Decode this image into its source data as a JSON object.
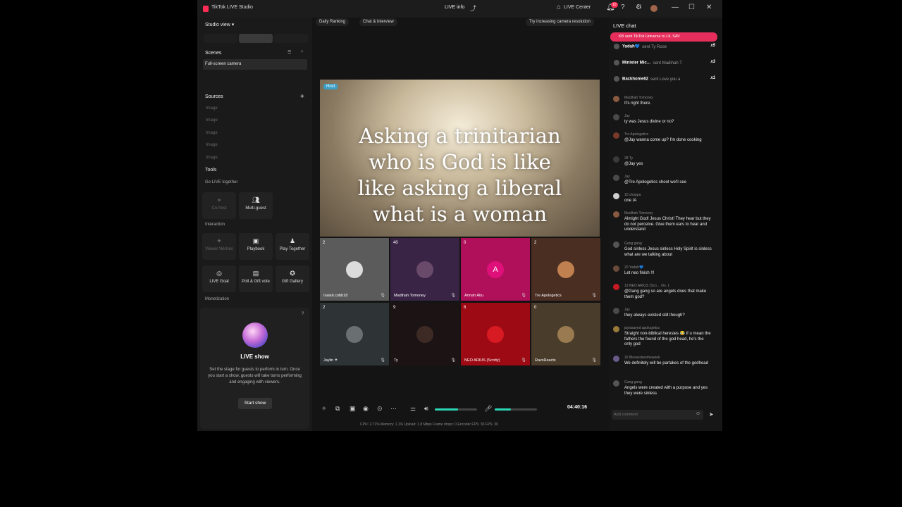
{
  "app": {
    "title": "TikTok LIVE Studio",
    "center_title": "LIVE info",
    "live_center": "LIVE Center",
    "notif_count": "10"
  },
  "sidebar": {
    "studio_view": "Studio view ▾",
    "scenes_header": "Scenes",
    "scene_item": "Full-screen camera",
    "sources_header": "Sources",
    "sources": [
      "Image",
      "Image",
      "Image",
      "Image",
      "Image"
    ],
    "tools_header": "Tools",
    "go_live_together": "Go LIVE together",
    "tools_golive": [
      "Co-host",
      "Multi-guest"
    ],
    "interaction": "Interaction",
    "tools_interaction": [
      "Viewer Wishes",
      "Playbook",
      "Play Together",
      "LIVE Goal",
      "Poll & Gift vote",
      "Gift Gallery"
    ],
    "monetization": "Monetization",
    "live_show": {
      "title": "LIVE show",
      "desc": "Set the stage for guests to perform in turn. Once you start a show, guests will take turns performing and engaging with viewers.",
      "button": "Start show"
    }
  },
  "top_pills": {
    "daily_ranking": "Daily Ranking",
    "chat_interview": "Chat & interview",
    "tip": "Try increasing camera resolution"
  },
  "main_video": {
    "host_tag": "Host",
    "lines": [
      "Asking a trinitarian",
      "who is God is like",
      "like asking a liberal",
      "what is a woman"
    ]
  },
  "guests": [
    {
      "count": "2",
      "name": "Isaiah.cobb18",
      "color": "#5b5b5b",
      "avatar": "#dcdcdc"
    },
    {
      "count": "40",
      "name": "Madihah Tomoney",
      "color": "#3a2446",
      "avatar": "#6a4a6a"
    },
    {
      "count": "0",
      "name": "Armah Abu",
      "color": "#b0105a",
      "avatar": "#e0107a",
      "initial": "A"
    },
    {
      "count": "2",
      "name": "Tre Apologetics",
      "color": "#4a2e22",
      "avatar": "#c08050"
    },
    {
      "count": "2",
      "name": "Jaylin ✝",
      "color": "#2e3436",
      "avatar": "#6a7072"
    },
    {
      "count": "9",
      "name": "Ty",
      "color": "#1c1414",
      "avatar": "#3e2a24"
    },
    {
      "count": "6",
      "name": "NEO ARIUS (Scotty)",
      "color": "#9e0a14",
      "avatar": "#d81a22"
    },
    {
      "count": "0",
      "name": "RavsReacts",
      "color": "#4a3c2a",
      "avatar": "#9a7a50"
    }
  ],
  "toolbar": {
    "timer": "04:40:16",
    "speaker_level": 0.55,
    "mic_level": 0.38
  },
  "stats": "CPU: 2.71%    Memory: 1.1%    Upload: 1.8 Mbps    Frame drops: 0    Encoder FPS: 30    FPS: 30",
  "chat": {
    "header": "LIVE chat",
    "banner": "KB sent TikTok Universe to LIL SAV",
    "gifts": [
      {
        "user": "Yadah💙",
        "text": "sent Ty Rose",
        "mult": "x5"
      },
      {
        "user": "Minister Mic…",
        "text": "sent Madihah T",
        "mult": "x3"
      },
      {
        "user": "Backhome62",
        "text": "sent Love you a",
        "mult": "x1"
      }
    ],
    "messages": [
      {
        "name": "Madihah Tomoney",
        "text": "It's right there."
      },
      {
        "name": "Jay",
        "text": "ty was Jesus divine or no?"
      },
      {
        "name": "Tre Apologetics",
        "text": "@Jay wanna come up? I'm done cooking"
      },
      {
        "name": "28 Ty",
        "text": "@Jay yes"
      },
      {
        "name": "Jay",
        "text": "@Tre Apologetics shoot we'll see"
      },
      {
        "name": "10 choppa",
        "text": "one IA"
      },
      {
        "name": "Madihah Tomoney",
        "text": "Almight God! Jesus Christ! They hear but they do not perceive. Give them ears to hear and understand"
      },
      {
        "name": "Gang gang",
        "text": "God sinless Jesus sinless Holy Spirit is sinless what are we talking about"
      },
      {
        "name": "20 Yadah💙",
        "text": "Let neo finish !!!"
      },
      {
        "name": "13 NEO ARIUS (Sco… No. 1",
        "text": "@Gang gang so are angels does that make them god?"
      },
      {
        "name": "Jay",
        "text": "they always existed still though?"
      },
      {
        "name": "jayissaved apologetics",
        "text": "Straight non-biblical heresies 😂 if u mean the fathers the found of the god head, he's the only god"
      },
      {
        "name": "16 Blessedaretheweek",
        "text": "We definitely will be partakes of the godhead"
      },
      {
        "name": "Gang gang",
        "text": "Angels were created with a purpose and yes they were sinless"
      }
    ],
    "input_placeholder": "Add comment"
  }
}
